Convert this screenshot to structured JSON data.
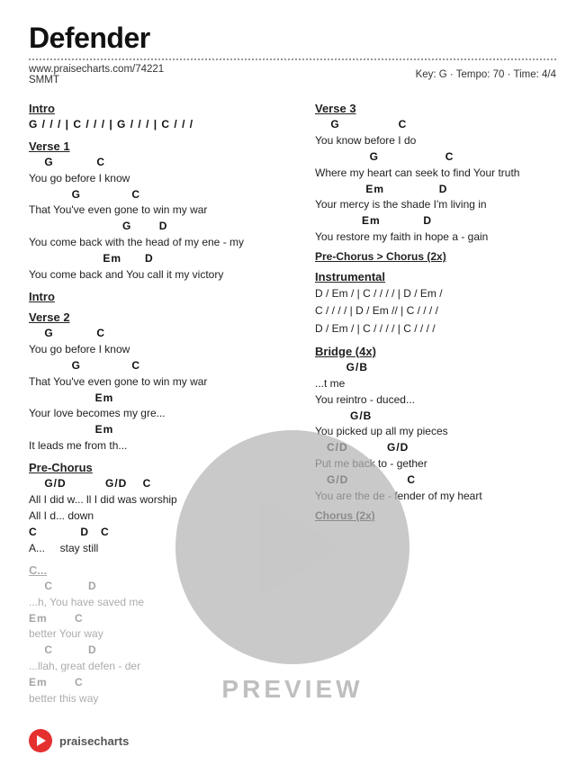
{
  "title": "Defender",
  "url": "www.praisecharts.com/74221",
  "code": "SMMT",
  "key": "Key: G",
  "tempo": "Tempo: 70",
  "time": "Time: 4/4",
  "left_column": {
    "sections": [
      {
        "id": "intro",
        "label": "Intro",
        "lines": [
          {
            "type": "chord",
            "text": "G / / /  |  C / / /  |  G / / /  |  C / / /"
          }
        ]
      },
      {
        "id": "verse1",
        "label": "Verse 1",
        "lines": [
          {
            "type": "chord",
            "text": "    G            C"
          },
          {
            "type": "lyric",
            "text": "You go before I know"
          },
          {
            "type": "chord",
            "text": "            G              C"
          },
          {
            "type": "lyric",
            "text": "That You've even gone to win my war"
          },
          {
            "type": "chord",
            "text": "                              G        D"
          },
          {
            "type": "lyric",
            "text": "You come back with the head of my ene - my"
          },
          {
            "type": "chord",
            "text": "                    Em       D"
          },
          {
            "type": "lyric",
            "text": "You come back and You call it my victory"
          }
        ]
      },
      {
        "id": "intro2",
        "label": "Intro",
        "lines": []
      },
      {
        "id": "verse2",
        "label": "Verse 2",
        "lines": [
          {
            "type": "chord",
            "text": "    G            C"
          },
          {
            "type": "lyric",
            "text": "You go before I know"
          },
          {
            "type": "chord",
            "text": "            G              C"
          },
          {
            "type": "lyric",
            "text": "That You've even gone to win my war"
          },
          {
            "type": "chord",
            "text": "                  Em"
          },
          {
            "type": "lyric",
            "text": "Your love becomes my gre..."
          },
          {
            "type": "chord",
            "text": "                  Em"
          },
          {
            "type": "lyric",
            "text": "It leads me from th..."
          }
        ]
      },
      {
        "id": "pre-chorus-left",
        "label": "Pre-Chorus",
        "lines": [
          {
            "type": "chord",
            "text": "    G/D          G/D    C"
          },
          {
            "type": "lyric",
            "text": "All I did w...  ll I did was worship"
          },
          {
            "type": "chord",
            "text": ""
          },
          {
            "type": "lyric",
            "text": "All I d...  down"
          },
          {
            "type": "chord",
            "text": "C           D   C"
          },
          {
            "type": "lyric",
            "text": "A...     stay still"
          }
        ]
      },
      {
        "id": "chorus-left",
        "label": "Chorus",
        "lines": [
          {
            "type": "chord",
            "text": "     C         D"
          },
          {
            "type": "lyric",
            "text": "...h, You have saved me"
          },
          {
            "type": "chord",
            "text": "Em       C"
          },
          {
            "type": "lyric",
            "text": "better Your way"
          },
          {
            "type": "chord",
            "text": "     C         D"
          },
          {
            "type": "lyric",
            "text": "...llah, great defen - der"
          },
          {
            "type": "chord",
            "text": "Em       C"
          },
          {
            "type": "lyric",
            "text": "better this way"
          }
        ]
      }
    ]
  },
  "right_column": {
    "sections": [
      {
        "id": "verse3",
        "label": "Verse 3",
        "lines": [
          {
            "type": "chord",
            "text": "    G                C"
          },
          {
            "type": "lyric",
            "text": "You know before I do"
          },
          {
            "type": "chord",
            "text": "               G                 C"
          },
          {
            "type": "lyric",
            "text": "Where my heart can seek to find Your truth"
          },
          {
            "type": "chord",
            "text": "              Em               D"
          },
          {
            "type": "lyric",
            "text": "Your mercy is the shade I'm living in"
          },
          {
            "type": "chord",
            "text": "             Em            D"
          },
          {
            "type": "lyric",
            "text": "You restore my faith in hope a - gain"
          }
        ]
      },
      {
        "id": "pre-chorus-ref",
        "label": "Pre-Chorus > Chorus (2x)",
        "lines": []
      },
      {
        "id": "instrumental",
        "label": "Instrumental",
        "lines": [
          {
            "type": "chord",
            "text": "D / Em /  |  C / / / /  |  D / Em /"
          },
          {
            "type": "chord",
            "text": "C / / / /  |  D / Em //  |  C / / / /"
          },
          {
            "type": "chord",
            "text": "D / Em /  |  C / / / /  |  C / / / /"
          }
        ]
      },
      {
        "id": "bridge",
        "label": "Bridge (4x)",
        "lines": [
          {
            "type": "chord",
            "text": "        G/B"
          },
          {
            "type": "lyric",
            "text": "...t me"
          },
          {
            "type": "chord",
            "text": ""
          },
          {
            "type": "lyric",
            "text": "You reintro - duced..."
          },
          {
            "type": "chord",
            "text": "         G/B"
          },
          {
            "type": "lyric",
            "text": "You picked up all my pieces"
          },
          {
            "type": "chord",
            "text": "   C/D          G/D"
          },
          {
            "type": "lyric",
            "text": "Put me back to - gether"
          },
          {
            "type": "chord",
            "text": "   G/D               C"
          },
          {
            "type": "lyric",
            "text": "You are the de - fender of my heart"
          }
        ]
      },
      {
        "id": "chorus-ref",
        "label": "Chorus (2x)",
        "lines": []
      }
    ]
  },
  "preview": {
    "label": "PREVIEW"
  },
  "footer": {
    "logo_alt": "PraiseCharts logo",
    "text": "praisecharts"
  }
}
